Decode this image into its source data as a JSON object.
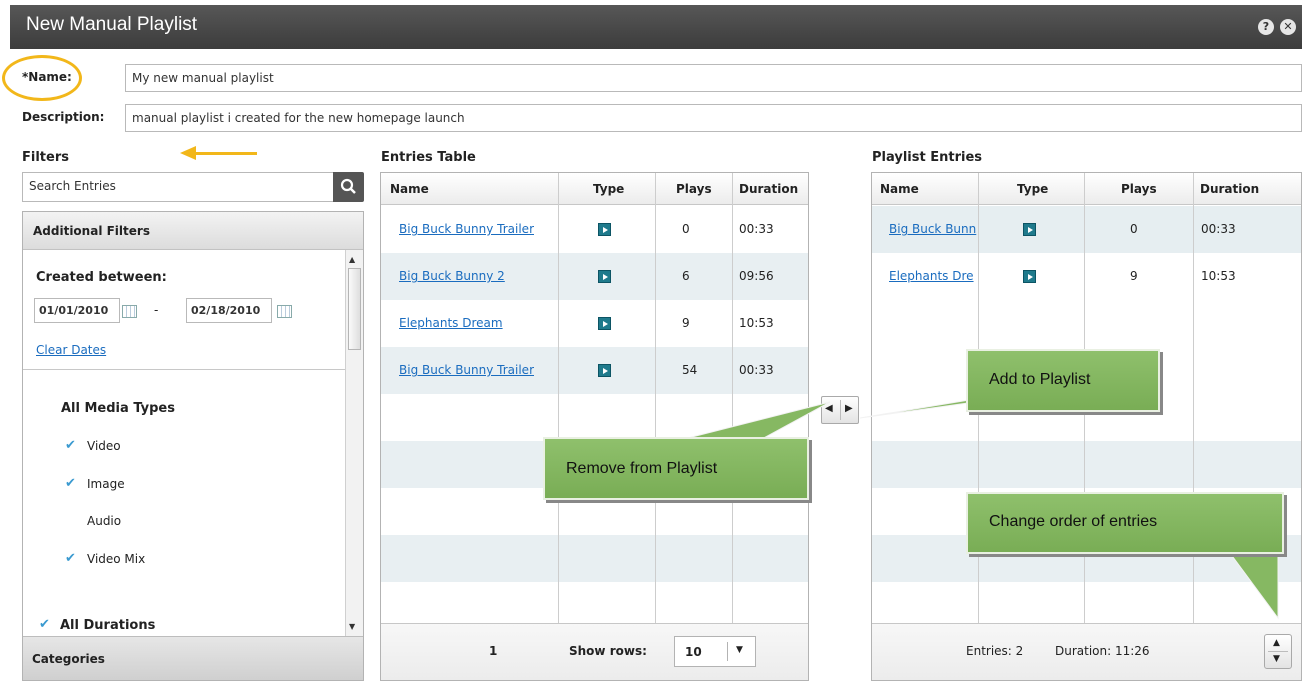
{
  "window": {
    "title": "New Manual Playlist",
    "help": "?",
    "close": "✕"
  },
  "form": {
    "name_label": "*Name:",
    "name_value": "My new manual playlist",
    "desc_label": "Description:",
    "desc_value": "manual playlist i created for the new homepage launch"
  },
  "filters": {
    "title": "Filters",
    "search_placeholder": "Search  Entries",
    "additional_label": "Additional Filters",
    "created_label": "Created between:",
    "date_from": "01/01/2010",
    "date_to": "02/18/2010",
    "dash": "-",
    "clear_dates": "Clear Dates",
    "media_types_label": "All Media Types",
    "media_types": [
      {
        "label": "Video",
        "checked": true
      },
      {
        "label": "Image",
        "checked": true
      },
      {
        "label": "Audio",
        "checked": false
      },
      {
        "label": "Video Mix",
        "checked": true
      }
    ],
    "durations_label": "All Durations",
    "categories_label": "Categories"
  },
  "entries": {
    "title": "Entries Table",
    "columns": [
      "Name",
      "Type",
      "Plays",
      "Duration"
    ],
    "rows": [
      {
        "name": "Big Buck Bunny Trailer",
        "plays": "0",
        "duration": "00:33"
      },
      {
        "name": "Big Buck Bunny  2",
        "plays": "6",
        "duration": "09:56"
      },
      {
        "name": "Elephants Dream",
        "plays": "9",
        "duration": "10:53"
      },
      {
        "name": "Big Buck Bunny Trailer",
        "plays": "54",
        "duration": "00:33"
      }
    ],
    "page": "1",
    "show_rows_label": "Show rows:",
    "show_rows_value": "10"
  },
  "playlist": {
    "title": "Playlist Entries",
    "columns": [
      "Name",
      "Type",
      "Plays",
      "Duration"
    ],
    "rows": [
      {
        "name": "Big Buck Bunn",
        "plays": "0",
        "duration": "00:33"
      },
      {
        "name": "Elephants Dre",
        "plays": "9",
        "duration": "10:53"
      }
    ],
    "entries_label": "Entries: 2",
    "duration_label": "Duration: 11:26"
  },
  "callouts": {
    "add": "Add to Playlist",
    "remove": "Remove from Playlist",
    "order": "Change order of entries"
  },
  "colors": {
    "titlebar": "#4a4a4a",
    "callout": "#86b862",
    "highlight_circle": "#f2b71a",
    "arrow": "#f2b71a",
    "link": "#1a6cbf"
  }
}
